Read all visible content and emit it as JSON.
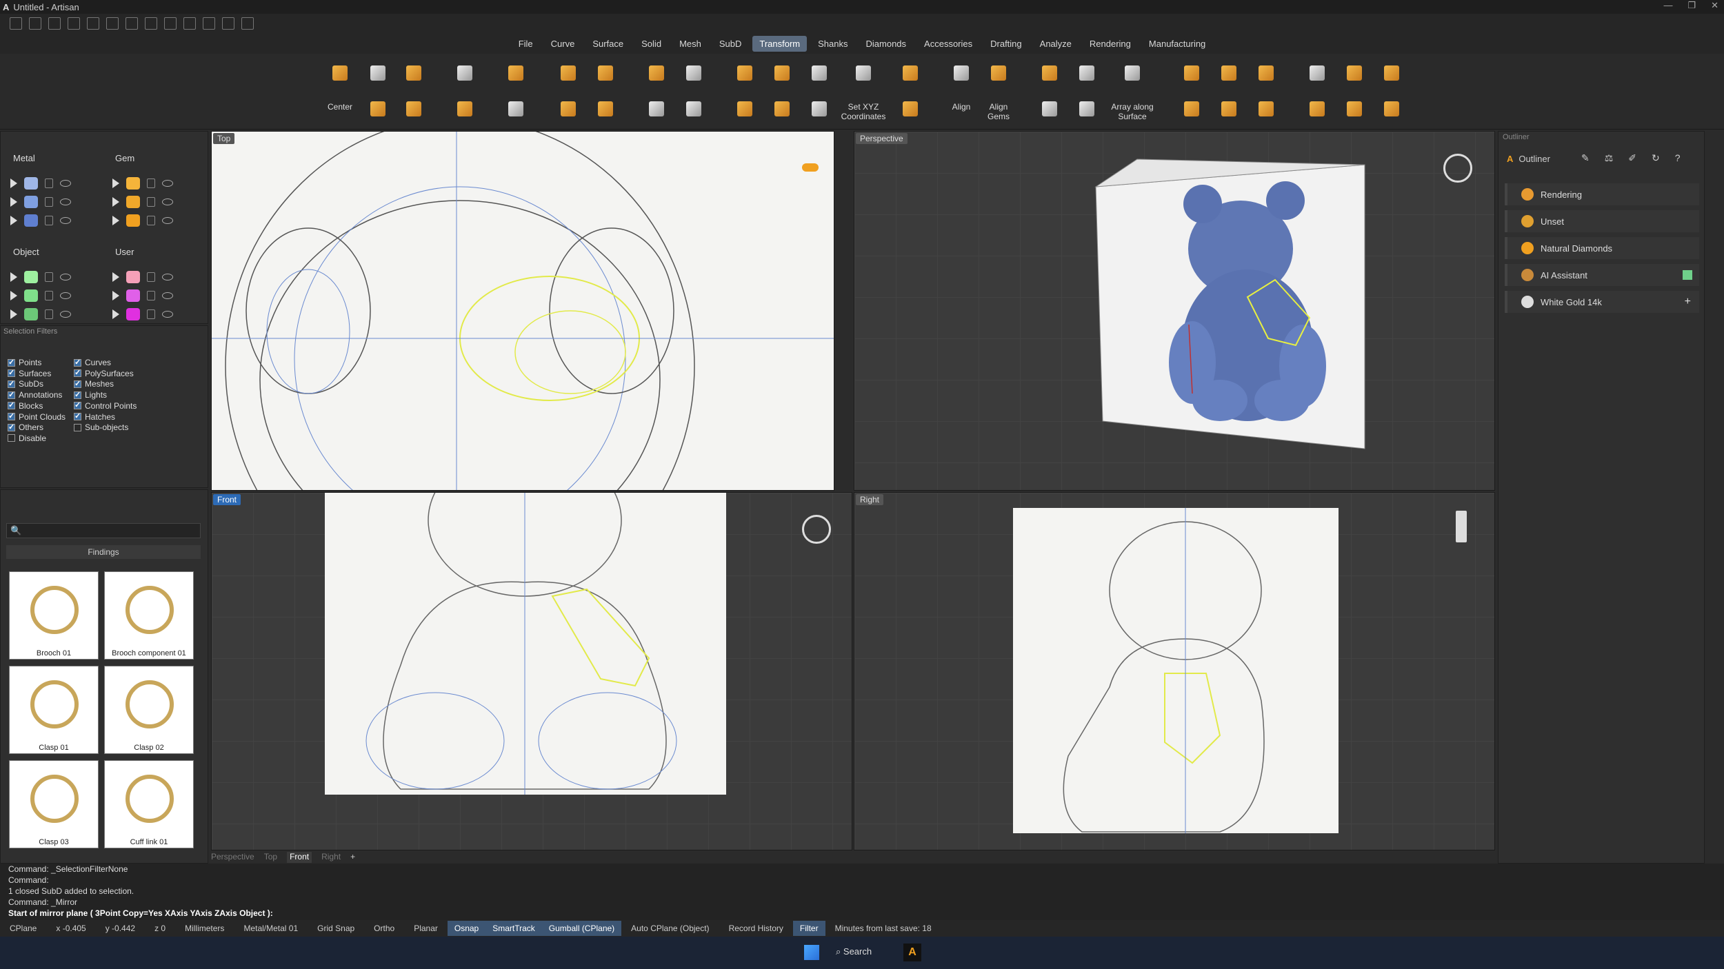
{
  "window": {
    "title": "Untitled - Artisan"
  },
  "menu": [
    "File",
    "Curve",
    "Surface",
    "Solid",
    "Mesh",
    "SubD",
    "Transform",
    "Shanks",
    "Diamonds",
    "Accessories",
    "Drafting",
    "Analyze",
    "Rendering",
    "Manufacturing"
  ],
  "menu_active": "Transform",
  "toolbar": {
    "center": "Center",
    "set_xyz_1": "Set XYZ",
    "set_xyz_2": "Coordinates",
    "align": "Align",
    "align_gems_1": "Align",
    "align_gems_2": "Gems",
    "array_1": "Array along",
    "array_2": "Surface"
  },
  "layers": {
    "metal": "Metal",
    "gem": "Gem",
    "object": "Object",
    "user": "User",
    "metal_colors": [
      "#9fb6e6",
      "#7f9fe0",
      "#5f7fd0"
    ],
    "gem_colors": [
      "#f5b43a",
      "#f0a82a",
      "#f0a020"
    ],
    "object_colors": [
      "#9ef0a0",
      "#7fe08a",
      "#6cc878"
    ],
    "user_colors": [
      "#f5a0b8",
      "#e060e8",
      "#e030e0"
    ]
  },
  "filters": {
    "title": "Selection Filters",
    "left": [
      {
        "label": "Points",
        "on": true
      },
      {
        "label": "Surfaces",
        "on": true
      },
      {
        "label": "SubDs",
        "on": true
      },
      {
        "label": "Annotations",
        "on": true
      },
      {
        "label": "Blocks",
        "on": true
      },
      {
        "label": "Point Clouds",
        "on": true
      },
      {
        "label": "Others",
        "on": true
      },
      {
        "label": "Disable",
        "on": false
      }
    ],
    "right": [
      {
        "label": "Curves",
        "on": true
      },
      {
        "label": "PolySurfaces",
        "on": true
      },
      {
        "label": "Meshes",
        "on": true
      },
      {
        "label": "Lights",
        "on": true
      },
      {
        "label": "Control Points",
        "on": true
      },
      {
        "label": "Hatches",
        "on": true
      },
      {
        "label": "Sub-objects",
        "on": false
      }
    ]
  },
  "library": {
    "category": "Findings",
    "items": [
      "Brooch 01",
      "Brooch component 01",
      "Clasp 01",
      "Clasp 02",
      "Clasp 03",
      "Cuff link 01"
    ]
  },
  "viewports": {
    "top": "Top",
    "perspective": "Perspective",
    "front": "Front",
    "right": "Right"
  },
  "viewport_tabs": [
    "Perspective",
    "Top",
    "Front",
    "Right"
  ],
  "outliner": {
    "title": "Outliner",
    "header": "Outliner",
    "rows": [
      "Rendering",
      "Unset",
      "Natural Diamonds",
      "AI Assistant",
      "White Gold 14k"
    ]
  },
  "command": {
    "lines": [
      "Command: _SelectionFilterNone",
      "Command:",
      "1 closed SubD added to selection.",
      "Command: _Mirror"
    ],
    "prompt": "Start of mirror plane ( 3Point  Copy=Yes  XAxis  YAxis  ZAxis  Object ):"
  },
  "status": {
    "cplane": "CPlane",
    "x": "x -0.405",
    "y": "y -0.442",
    "z": "z 0",
    "units": "Millimeters",
    "layer": "Metal/Metal 01",
    "grid_snap": "Grid Snap",
    "ortho": "Ortho",
    "planar": "Planar",
    "osnap": "Osnap",
    "smarttrack": "SmartTrack",
    "gumball": "Gumball (CPlane)",
    "auto_cplane": "Auto CPlane (Object)",
    "record": "Record History",
    "filter": "Filter",
    "save": "Minutes from last save: 18"
  },
  "taskbar": {
    "search": "Search"
  },
  "colors": {
    "accent": "#2d6bb6",
    "menu_active": "#5a6a7e",
    "subd": "#4f6aa8",
    "selection": "#e8f040"
  }
}
